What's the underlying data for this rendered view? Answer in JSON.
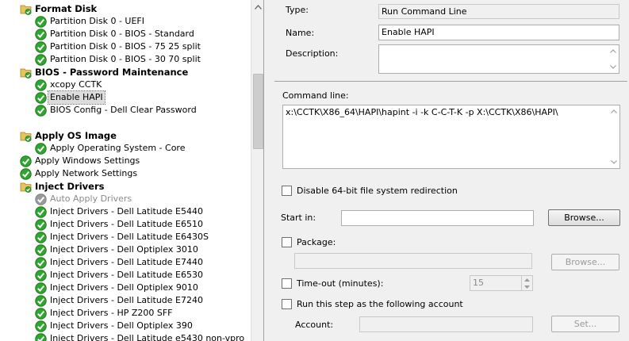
{
  "tree": {
    "items": [
      {
        "label": "Format Disk",
        "type": "folder",
        "level": 0
      },
      {
        "label": "Partition Disk 0 - UEFI",
        "type": "check",
        "level": 1
      },
      {
        "label": "Partition Disk 0 - BIOS - Standard",
        "type": "check",
        "level": 1
      },
      {
        "label": "Partition Disk 0 - BIOS - 75 25 split",
        "type": "check",
        "level": 1
      },
      {
        "label": "Partition Disk 0 - BIOS - 30 70 split",
        "type": "check",
        "level": 1
      },
      {
        "label": "BIOS - Password Maintenance",
        "type": "folder",
        "level": 0
      },
      {
        "label": "xcopy CCTK",
        "type": "check",
        "level": 1
      },
      {
        "label": "Enable HAPI",
        "type": "check",
        "level": 1,
        "selected": true
      },
      {
        "label": "BIOS Config - Dell Clear Password",
        "type": "check",
        "level": 1
      },
      {
        "label": "Apply OS Image",
        "type": "folder",
        "level": 0,
        "gap": true
      },
      {
        "label": "Apply Operating System - Core",
        "type": "check",
        "level": 1
      },
      {
        "label": "Apply Windows Settings",
        "type": "check",
        "level": 0
      },
      {
        "label": "Apply Network Settings",
        "type": "check",
        "level": 0
      },
      {
        "label": "Inject Drivers",
        "type": "folder",
        "level": 0
      },
      {
        "label": "Auto Apply Drivers",
        "type": "disabled",
        "level": 1
      },
      {
        "label": "Inject Drivers - Dell Latitude E5440",
        "type": "check",
        "level": 1
      },
      {
        "label": "Inject Drivers - Dell Latitude E6510",
        "type": "check",
        "level": 1
      },
      {
        "label": "Inject Drivers - Dell Latitude E6430S",
        "type": "check",
        "level": 1
      },
      {
        "label": "Inject Drivers - Dell Optiplex 3010",
        "type": "check",
        "level": 1
      },
      {
        "label": "Inject Drivers - Dell Latitude E7440",
        "type": "check",
        "level": 1
      },
      {
        "label": "Inject Drivers - Dell Latitude E6530",
        "type": "check",
        "level": 1
      },
      {
        "label": "Inject Drivers - Dell Optiplex 9010",
        "type": "check",
        "level": 1
      },
      {
        "label": "Inject Drivers - Dell Latitude E7240",
        "type": "check",
        "level": 1
      },
      {
        "label": "Inject Drivers - HP Z200 SFF",
        "type": "check",
        "level": 1
      },
      {
        "label": "Inject Drivers - Dell Optiplex 390",
        "type": "check",
        "level": 1
      },
      {
        "label": "Inject Drivers - Dell Latitude e5430 non-vpro",
        "type": "check",
        "level": 1
      }
    ]
  },
  "props": {
    "type_label": "Type:",
    "type_value": "Run Command Line",
    "name_label": "Name:",
    "name_value": "Enable HAPI",
    "description_label": "Description:",
    "description_value": "",
    "command_label": "Command line:",
    "command_value": "x:\\CCTK\\X86_64\\HAPI\\hapint -i -k C-C-T-K -p X:\\CCTK\\X86\\HAPI\\",
    "disable64_label": "Disable 64-bit file system redirection",
    "disable64_checked": false,
    "startin_label": "Start in:",
    "startin_value": "",
    "browse_label": "Browse...",
    "package_label": "Package:",
    "package_checked": false,
    "package_value": "",
    "package_browse_label": "Browse...",
    "timeout_label": "Time-out (minutes):",
    "timeout_checked": false,
    "timeout_value": "15",
    "runas_label": "Run this step as the following account",
    "runas_checked": false,
    "account_label": "Account:",
    "account_value": "",
    "set_label": "Set..."
  },
  "colors": {
    "check_green": "#2ea52e",
    "folder_yellow": "#e8c25a",
    "disabled_gray": "#9a9a9a"
  }
}
